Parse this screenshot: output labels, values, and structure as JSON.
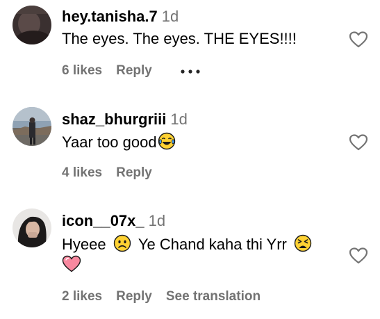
{
  "comments": [
    {
      "username": "hey.tanisha.7",
      "time": "1d",
      "text": "The eyes. The eyes. THE EYES!!!!",
      "likes": "6 likes",
      "reply": "Reply"
    },
    {
      "username": "shaz_bhurgriii",
      "time": "1d",
      "text": "Yaar too good",
      "likes": "4 likes",
      "reply": "Reply"
    },
    {
      "username": "icon__07x_",
      "time": "1d",
      "text_part1": "Hyeee",
      "text_part2": "Ye Chand kaha thi Yrr",
      "likes": "2 likes",
      "reply": "Reply",
      "see_translation": "See translation"
    }
  ],
  "icons": {
    "like": "heart-outline-icon",
    "more": "more-options-icon",
    "emoji_laugh": "face-with-tears-of-joy",
    "emoji_sad": "frowning-face",
    "emoji_tired": "tired-face",
    "emoji_heart": "pink-heart"
  }
}
